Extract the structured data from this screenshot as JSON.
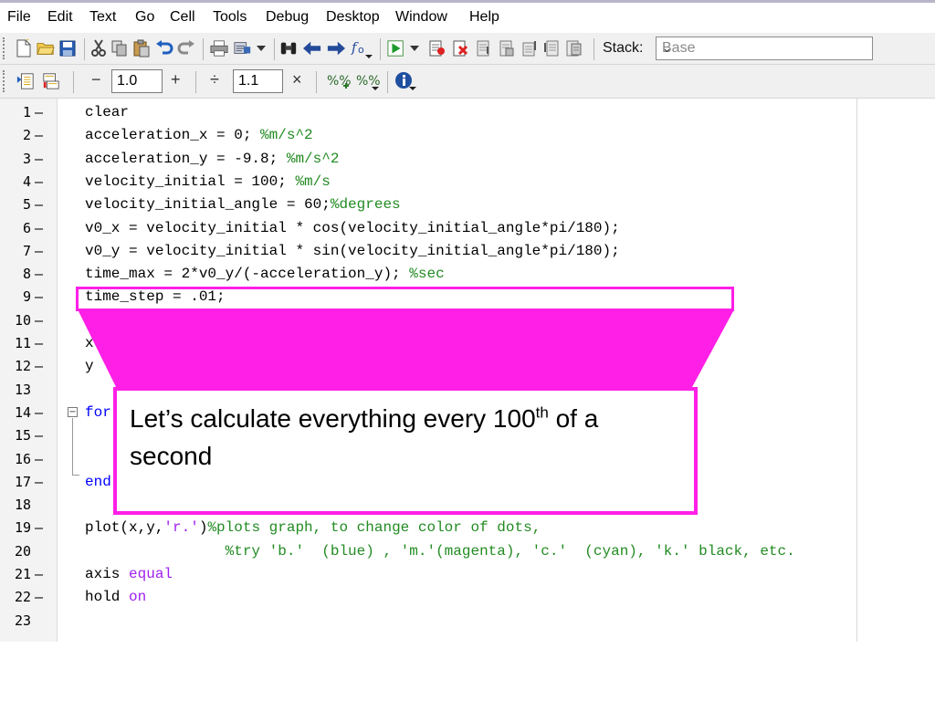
{
  "menu": [
    "File",
    "Edit",
    "Text",
    "Go",
    "Cell",
    "Tools",
    "Debug",
    "Desktop",
    "Window",
    "Help"
  ],
  "toolbar": {
    "stack_label": "Stack:",
    "stack_value": "Base",
    "icons": [
      "new-file-icon",
      "open-folder-icon",
      "save-icon",
      "cut-icon",
      "copy-icon",
      "paste-icon",
      "undo-icon",
      "redo-icon",
      "print-icon",
      "find-files-icon",
      "dropdown-icon",
      "binoculars-icon",
      "back-arrow-icon",
      "forward-arrow-icon",
      "function-icon",
      "run-icon",
      "set-breakpoint-icon",
      "clear-breakpoint-icon",
      "step-icon",
      "step-in-icon",
      "step-out-icon",
      "continue-icon",
      "exit-debug-icon"
    ]
  },
  "cell_toolbar": {
    "minus": "−",
    "increment_value": "1.0",
    "plus": "+",
    "divide": "÷",
    "factor_value": "1.1",
    "times": "×",
    "icons": [
      "evaluate-cell-icon",
      "evaluate-cell-advance-icon",
      "insert-cell-percent-icon",
      "cell-percent-dropdown-icon",
      "cell-info-icon"
    ]
  },
  "editor": {
    "lines": [
      {
        "n": "1",
        "dash": true,
        "segments": [
          {
            "t": "clear",
            "c": ""
          }
        ]
      },
      {
        "n": "2",
        "dash": true,
        "segments": [
          {
            "t": "acceleration_x = 0; ",
            "c": ""
          },
          {
            "t": "%m/s^2",
            "c": "cm"
          }
        ]
      },
      {
        "n": "3",
        "dash": true,
        "segments": [
          {
            "t": "acceleration_y = -9.8; ",
            "c": ""
          },
          {
            "t": "%m/s^2",
            "c": "cm"
          }
        ]
      },
      {
        "n": "4",
        "dash": true,
        "segments": [
          {
            "t": "velocity_initial = 100; ",
            "c": ""
          },
          {
            "t": "%m/s",
            "c": "cm"
          }
        ]
      },
      {
        "n": "5",
        "dash": true,
        "segments": [
          {
            "t": "velocity_initial_angle = 60;",
            "c": ""
          },
          {
            "t": "%degrees",
            "c": "cm"
          }
        ]
      },
      {
        "n": "6",
        "dash": true,
        "segments": [
          {
            "t": "v0_x = velocity_initial * cos(velocity_initial_angle*pi/180);",
            "c": ""
          }
        ]
      },
      {
        "n": "7",
        "dash": true,
        "segments": [
          {
            "t": "v0_y = velocity_initial * sin(velocity_initial_angle*pi/180);",
            "c": ""
          }
        ]
      },
      {
        "n": "8",
        "dash": true,
        "segments": [
          {
            "t": "time_max = 2*v0_y/(-acceleration_y); ",
            "c": ""
          },
          {
            "t": "%sec",
            "c": "cm"
          }
        ]
      },
      {
        "n": "9",
        "dash": true,
        "segments": [
          {
            "t": "time_step = .01;",
            "c": ""
          }
        ]
      },
      {
        "n": "10",
        "dash": true,
        "segments": []
      },
      {
        "n": "11",
        "dash": true,
        "segments": [
          {
            "t": "x",
            "c": ""
          }
        ]
      },
      {
        "n": "12",
        "dash": true,
        "segments": [
          {
            "t": "y",
            "c": ""
          }
        ]
      },
      {
        "n": "13",
        "dash": false,
        "segments": []
      },
      {
        "n": "14",
        "dash": true,
        "segments": [
          {
            "t": "for",
            "c": "kw"
          }
        ]
      },
      {
        "n": "15",
        "dash": true,
        "segments": []
      },
      {
        "n": "16",
        "dash": true,
        "segments": []
      },
      {
        "n": "17",
        "dash": true,
        "segments": [
          {
            "t": "end",
            "c": "kw"
          }
        ]
      },
      {
        "n": "18",
        "dash": false,
        "segments": []
      },
      {
        "n": "19",
        "dash": true,
        "segments": [
          {
            "t": "plot(x,y,",
            "c": ""
          },
          {
            "t": "'r.'",
            "c": "st"
          },
          {
            "t": ")",
            "c": ""
          },
          {
            "t": "%plots graph, to change color of dots,",
            "c": "cm"
          }
        ]
      },
      {
        "n": "20",
        "dash": false,
        "segments": [
          {
            "t": "                ",
            "c": ""
          },
          {
            "t": "%try 'b.'  (blue) , 'm.'(magenta), 'c.'  (cyan), 'k.' black, etc.",
            "c": "cm"
          }
        ]
      },
      {
        "n": "21",
        "dash": true,
        "segments": [
          {
            "t": "axis ",
            "c": ""
          },
          {
            "t": "equal",
            "c": "st"
          }
        ]
      },
      {
        "n": "22",
        "dash": true,
        "segments": [
          {
            "t": "hold ",
            "c": ""
          },
          {
            "t": "on",
            "c": "st"
          }
        ]
      },
      {
        "n": "23",
        "dash": false,
        "segments": []
      }
    ]
  },
  "callout": {
    "text_before": "Let’s calculate everything every 100",
    "superscript": "th",
    "text_after": " of a second"
  },
  "colors": {
    "callout_accent": "#ff1fe6",
    "keyword": "#0000ff",
    "comment": "#228b22",
    "string": "#a020f0"
  }
}
